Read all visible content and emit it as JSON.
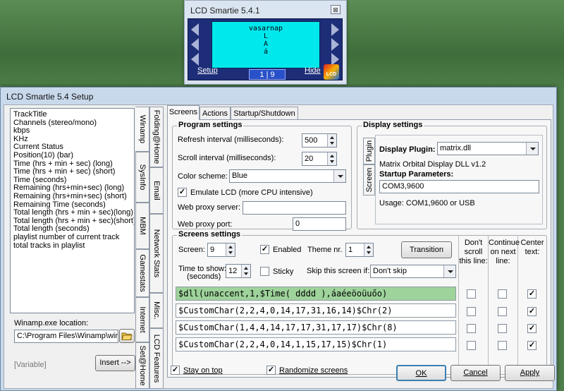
{
  "mini": {
    "title": "LCD Smartie 5.4.1",
    "close": "⊠",
    "lcd_lines": [
      "vasarnap",
      "L",
      "A",
      "á"
    ],
    "setup": "Setup",
    "hide": "Hide",
    "counter": "1 | 9",
    "logo_text": "LCD"
  },
  "window": {
    "title": "LCD Smartie 5.4 Setup"
  },
  "variables": [
    "TrackTitle",
    "Channels (stereo/mono)",
    "kbps",
    "KHz",
    "Current Status",
    "Position(10) (bar)",
    "Time (hrs + min + sec) (long)",
    "Time (hrs + min + sec) (short)",
    "Time (seconds)",
    "Remaining (hrs+min+sec) (long)",
    "Remaining (hrs+min+sec) (short)",
    "Remaining Time (seconds)",
    "Total length (hrs + min + sec)(long)",
    "Total length (hrs + min + sec)(short)",
    "Total length (seconds)",
    "playlist number of current track",
    "total tracks in playlist"
  ],
  "winamp": {
    "label": "Winamp.exe location:",
    "path": "C:\\Program Files\\Winamp\\winamp.exe",
    "variable": "[Variable]",
    "insert": "Insert -->"
  },
  "side_tabs_left": [
    "Winamp",
    "SysInfo",
    "MBM",
    "Gamestats",
    "Internet",
    "Set@Home"
  ],
  "side_tabs_right": [
    "Folding@Home",
    "Email",
    "Network Stats",
    "Misc.",
    "LCD Features"
  ],
  "tabs": [
    "Screens",
    "Actions",
    "Startup/Shutdown"
  ],
  "program": {
    "title": "Program settings",
    "refresh_label": "Refresh interval (milliseconds):",
    "refresh_value": "500",
    "scroll_label": "Scroll interval (milliseconds):",
    "scroll_value": "20",
    "color_label": "Color scheme:",
    "color_value": "Blue",
    "emulate_label": "Emulate LCD  (more CPU intensive)",
    "emulate_checked": true,
    "proxy_server_label": "Web proxy server:",
    "proxy_server_value": "",
    "proxy_port_label": "Web proxy port:",
    "proxy_port_value": "0"
  },
  "display": {
    "title": "Display settings",
    "tab_plugin": "Plugin",
    "tab_screen": "Screen",
    "plugin_label": "Display Plugin:",
    "plugin_value": "matrix.dll",
    "plugin_desc": "Matrix Orbital Display DLL v1.2",
    "startup_label": "Startup Parameters:",
    "startup_value": "COM3,9600",
    "usage": "Usage: COM1,9600 or USB"
  },
  "screens": {
    "title": "Screens settings",
    "screen_label": "Screen:",
    "screen_value": "9",
    "enabled_label": "Enabled",
    "enabled_checked": true,
    "theme_label": "Theme nr.",
    "theme_value": "1",
    "transition": "Transition",
    "time_label": "Time to show:",
    "time_sub": "(seconds)",
    "time_value": "12",
    "sticky_label": "Sticky",
    "sticky_checked": false,
    "skip_label": "Skip this screen if:",
    "skip_value": "Don't skip",
    "col_dont_scroll": "Don't scroll this line:",
    "col_continue": "Continue on next line:",
    "col_center": "Center text:",
    "lines": [
      {
        "text": "$dll(unaccent,1,$Time( dddd ),áaéeöoüuőo)",
        "noscroll": false,
        "cont": false,
        "center": true
      },
      {
        "text": "$CustomChar(2,2,4,0,14,17,31,16,14)$Chr(2)",
        "noscroll": false,
        "cont": false,
        "center": true
      },
      {
        "text": "$CustomChar(1,4,4,14,17,17,31,17,17)$Chr(8)",
        "noscroll": false,
        "cont": false,
        "center": true
      },
      {
        "text": "$CustomChar(2,2,4,0,14,1,15,17,15)$Chr(1)",
        "noscroll": false,
        "cont": false,
        "center": true
      }
    ]
  },
  "footer": {
    "stay_on_top": "Stay on top",
    "stay_on_top_checked": true,
    "randomize": "Randomize screens",
    "randomize_checked": true,
    "ok": "OK",
    "cancel": "Cancel",
    "apply": "Apply"
  }
}
